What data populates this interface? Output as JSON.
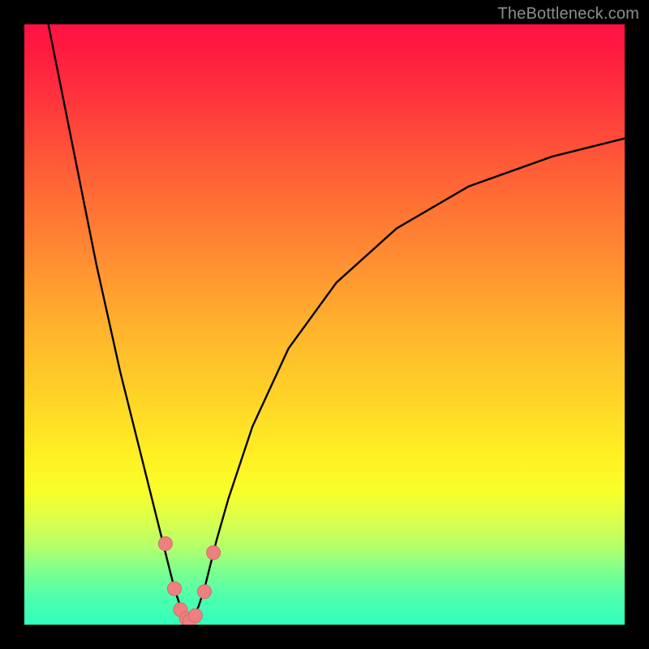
{
  "watermark": "TheBottleneck.com",
  "colors": {
    "frame": "#000000",
    "curve": "#000000",
    "marker_fill": "#f08080",
    "marker_stroke": "#d46a6a"
  },
  "chart_data": {
    "type": "line",
    "title": "",
    "xlabel": "",
    "ylabel": "",
    "xlim": [
      0,
      100
    ],
    "ylim": [
      0,
      100
    ],
    "series": [
      {
        "name": "bottleneck-curve",
        "x": [
          4,
          6,
          8,
          10,
          12,
          14,
          16,
          18,
          20,
          22,
          23,
          24,
          25,
          26,
          27,
          27.5,
          28,
          29,
          30,
          31,
          32,
          34,
          38,
          44,
          52,
          62,
          74,
          88,
          100
        ],
        "values": [
          100,
          90,
          80,
          70,
          60,
          51,
          42,
          34,
          26,
          18,
          14,
          10,
          6,
          3,
          1,
          0.5,
          1,
          3,
          6,
          10,
          14,
          21,
          33,
          46,
          57,
          66,
          73,
          78,
          81
        ]
      }
    ],
    "markers": {
      "name": "highlighted-points",
      "x": [
        23.5,
        25.0,
        26.0,
        27.0,
        27.5,
        28.5,
        30.0,
        31.5
      ],
      "values": [
        13.5,
        6.0,
        2.5,
        1.0,
        0.6,
        1.5,
        5.5,
        12.0
      ]
    },
    "annotations": []
  }
}
